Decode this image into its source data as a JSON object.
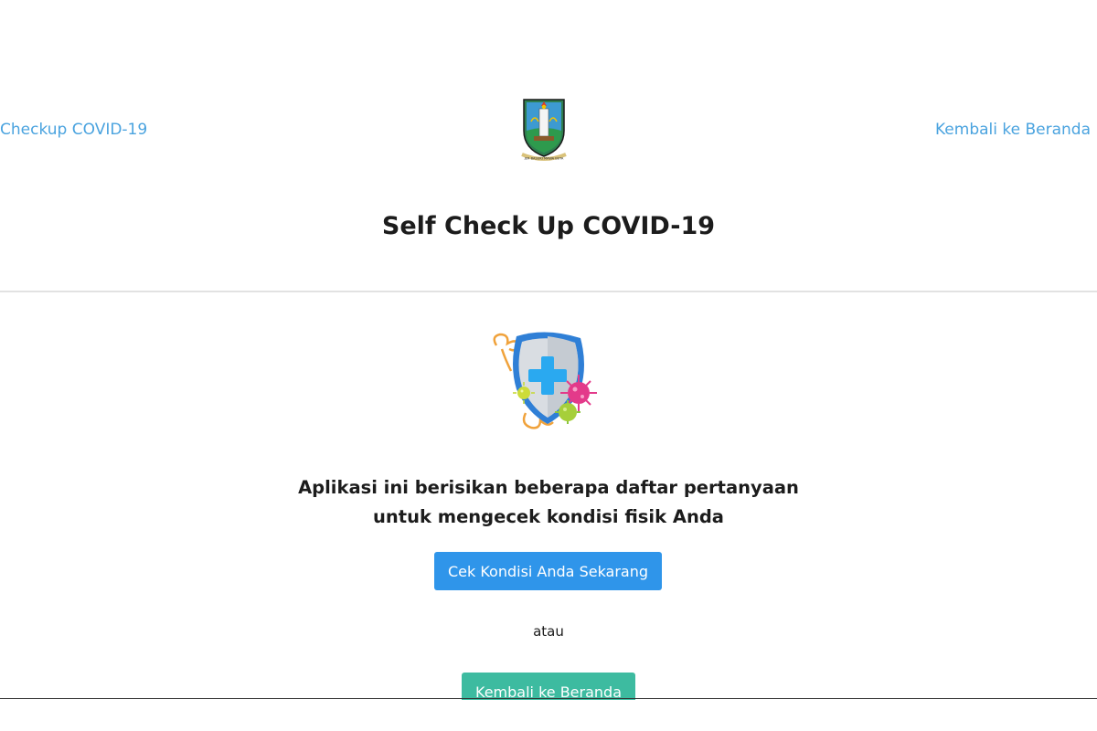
{
  "header": {
    "left_link": "Checkup COVID-19",
    "right_link": "Kembali ke Beranda",
    "logo_icon": "east-java-coat-of-arms-icon"
  },
  "main": {
    "title": "Self Check Up COVID-19",
    "illustration_icon": "shield-virus-icon",
    "description_line1": "Aplikasi ini berisikan beberapa daftar pertanyaan",
    "description_line2": "untuk mengecek kondisi fisik Anda",
    "primary_button": "Cek Kondisi Anda Sekarang",
    "or_text": "atau",
    "secondary_button": "Kembali ke Beranda"
  },
  "colors": {
    "link": "#4aa3df",
    "primary_button": "#2f95ea",
    "secondary_button": "#3dbba0",
    "text": "#1c1c1c"
  }
}
